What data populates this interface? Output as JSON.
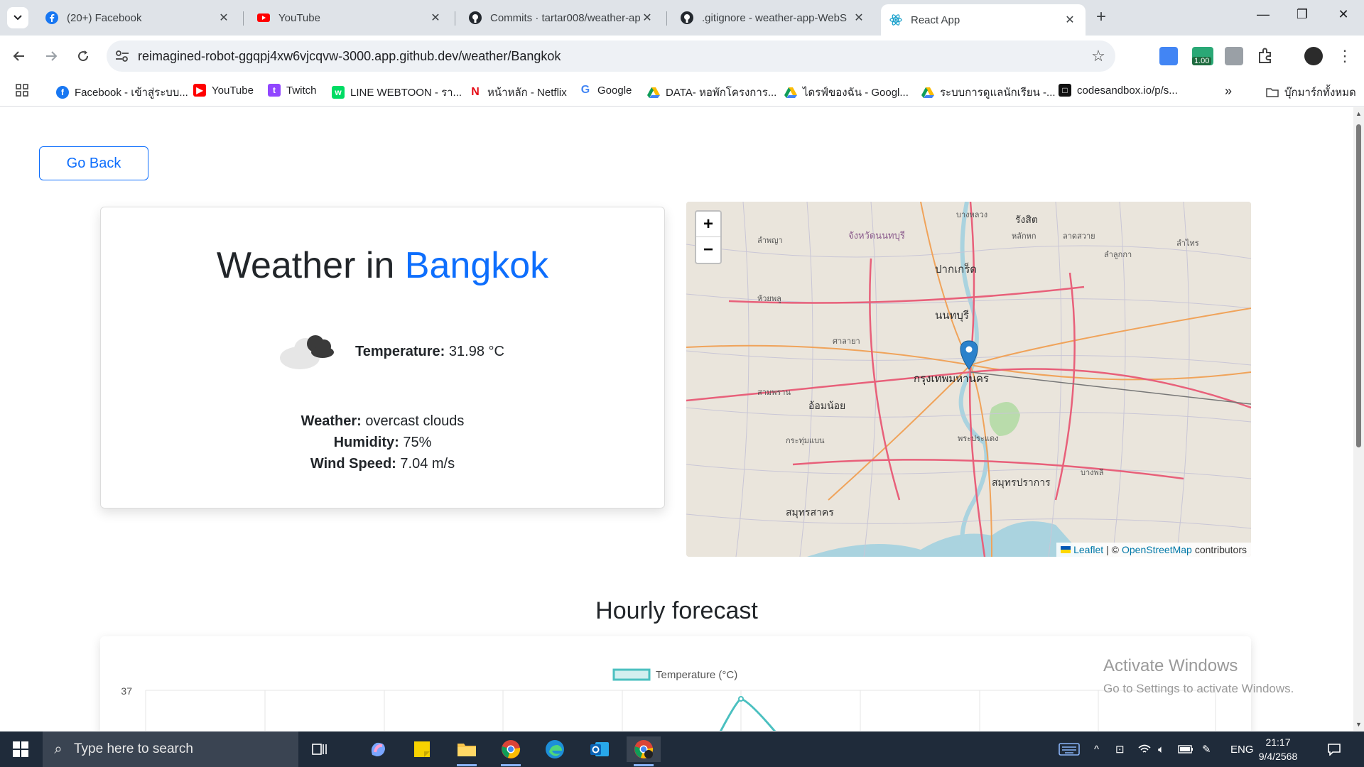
{
  "browser": {
    "tabs": [
      {
        "title": "(20+) Facebook",
        "icon": "facebook-icon",
        "active": false
      },
      {
        "title": "YouTube",
        "icon": "youtube-icon",
        "active": false
      },
      {
        "title": "Commits · tartar008/weather-ap",
        "icon": "github-icon",
        "active": false
      },
      {
        "title": ".gitignore - weather-app-WebS",
        "icon": "github-icon",
        "active": false
      },
      {
        "title": "React App",
        "icon": "react-icon",
        "active": true
      }
    ],
    "url": "reimagined-robot-ggqpj4xw6vjcqvw-3000.app.github.dev/weather/Bangkok",
    "extension_badge": "1.00",
    "bookmarks": [
      {
        "label": "Facebook - เข้าสู่ระบบ...",
        "icon": "facebook-icon"
      },
      {
        "label": "YouTube",
        "icon": "youtube-icon"
      },
      {
        "label": "Twitch",
        "icon": "twitch-icon"
      },
      {
        "label": "LINE WEBTOON - รา...",
        "icon": "webtoon-icon"
      },
      {
        "label": "หน้าหลัก - Netflix",
        "icon": "netflix-icon"
      },
      {
        "label": "Google",
        "icon": "google-icon"
      },
      {
        "label": "DATA- หอพักโครงการ...",
        "icon": "drive-icon"
      },
      {
        "label": "ไดรฟ์ของฉัน - Googl...",
        "icon": "drive-icon"
      },
      {
        "label": "ระบบการดูแลนักเรียน -...",
        "icon": "drive-icon"
      },
      {
        "label": "codesandbox.io/p/s...",
        "icon": "codesandbox-icon"
      }
    ],
    "all_bookmarks": "บุ๊กมาร์กทั้งหมด"
  },
  "app": {
    "go_back": "Go Back",
    "title_prefix": "Weather in",
    "city": "Bangkok",
    "temperature_label": "Temperature:",
    "temperature_value": "31.98 °C",
    "weather_label": "Weather:",
    "weather_value": "overcast clouds",
    "humidity_label": "Humidity:",
    "humidity_value": "75%",
    "wind_label": "Wind Speed:",
    "wind_value": "7.04 m/s",
    "weather_icon": "overcast-clouds-icon",
    "map": {
      "zoom_in": "+",
      "zoom_out": "−",
      "attribution_leaflet": "Leaflet",
      "attribution_sep": "| ©",
      "attribution_osm": "OpenStreetMap",
      "attribution_contrib": "contributors",
      "labels": [
        "บางหลวง",
        "รังสิต",
        "หลักหก",
        "ลาดสวาย",
        "ลำลูกกา",
        "ลำไทร",
        "จังหวัดนนทบุรี",
        "ลำพญา",
        "ปากเกร็ด",
        "ห้วยพลู",
        "นนทบุรี",
        "ศาลายา",
        "กรุงเทพมหานคร",
        "อ้อมน้อย",
        "สามพราน",
        "พระประแดง",
        "สมุทรปราการ",
        "สมุทรสาคร",
        "บางพลี",
        "กระทุ่มแบน"
      ]
    },
    "hourly_title": "Hourly forecast"
  },
  "chart_data": {
    "type": "line",
    "series": [
      {
        "name": "Temperature (°C)",
        "color": "#4bc0c0"
      }
    ],
    "y_tick_visible": "37"
  },
  "watermark": {
    "line1": "Activate Windows",
    "line2": "Go to Settings to activate Windows."
  },
  "taskbar": {
    "search_placeholder": "Type here to search",
    "lang": "ENG",
    "time": "21:17",
    "date": "9/4/2568"
  }
}
